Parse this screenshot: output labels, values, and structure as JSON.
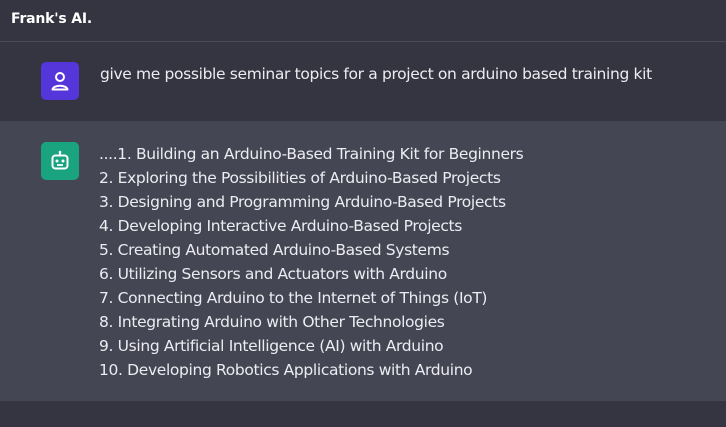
{
  "header": {
    "title": "Frank's AI."
  },
  "conversation": {
    "user_message": "give me possible seminar topics for a project on arduino based training kit",
    "user_avatar_icon": "person-icon",
    "bot_avatar_icon": "robot-icon",
    "bot_response_lines": [
      "....1. Building an Arduino-Based Training Kit for Beginners",
      "2. Exploring the Possibilities of Arduino-Based Projects",
      "3. Designing and Programming Arduino-Based Projects",
      "4. Developing Interactive Arduino-Based Projects",
      "5. Creating Automated Arduino-Based Systems",
      "6. Utilizing Sensors and Actuators with Arduino",
      "7. Connecting Arduino to the Internet of Things (IoT)",
      "8. Integrating Arduino with Other Technologies",
      "9. Using Artificial Intelligence (AI) with Arduino",
      "10. Developing Robotics Applications with Arduino"
    ]
  },
  "colors": {
    "background": "#343541",
    "bot_row": "#444654",
    "user_avatar": "#5436da",
    "bot_avatar": "#19a37f",
    "text": "#ececf1"
  }
}
